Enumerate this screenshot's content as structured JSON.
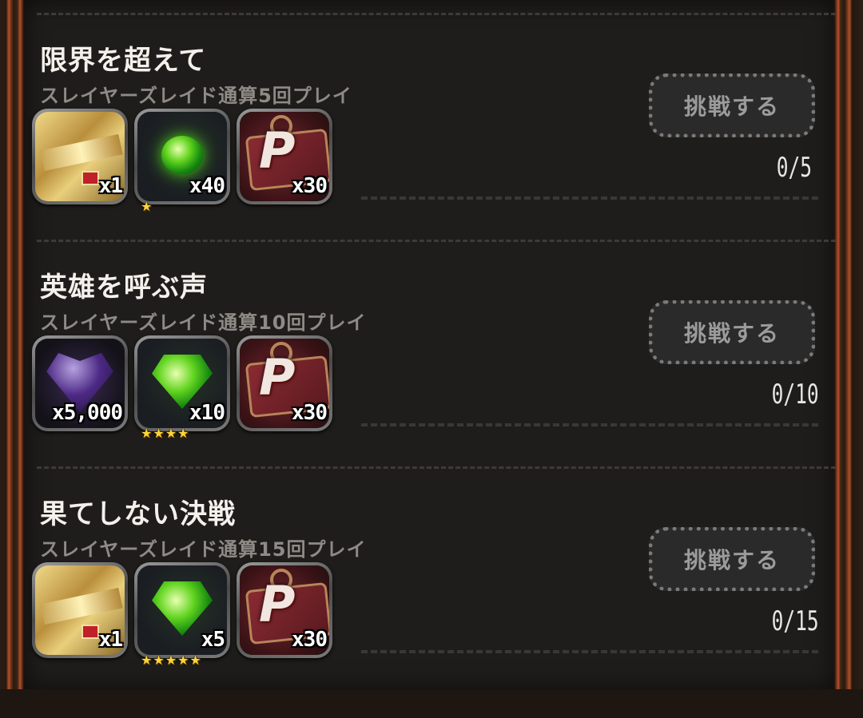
{
  "missions": [
    {
      "title": "限界を超えて",
      "description": "スレイヤーズレイド通算5回プレイ",
      "button_label": "挑戦する",
      "progress": "0/5",
      "rewards": [
        {
          "item": "gold-card",
          "count": "x1",
          "stars": ""
        },
        {
          "item": "green-orb",
          "count": "x40",
          "stars": "★"
        },
        {
          "item": "p-ticket",
          "count": "x30",
          "stars": ""
        }
      ]
    },
    {
      "title": "英雄を呼ぶ声",
      "description": "スレイヤーズレイド通算10回プレイ",
      "button_label": "挑戦する",
      "progress": "0/10",
      "rewards": [
        {
          "item": "purple-heart-gem",
          "count": "x5,000",
          "stars": ""
        },
        {
          "item": "green-gem",
          "count": "x10",
          "stars": "★★★★"
        },
        {
          "item": "p-ticket",
          "count": "x30",
          "stars": ""
        }
      ]
    },
    {
      "title": "果てしない決戦",
      "description": "スレイヤーズレイド通算15回プレイ",
      "button_label": "挑戦する",
      "progress": "0/15",
      "rewards": [
        {
          "item": "gold-card",
          "count": "x1",
          "stars": ""
        },
        {
          "item": "green-gem",
          "count": "x5",
          "stars": "★★★★★"
        },
        {
          "item": "p-ticket",
          "count": "x30",
          "stars": ""
        }
      ]
    }
  ],
  "icons": {
    "ticket_letter": "P"
  },
  "colors": {
    "title": "#f4f1ec",
    "description": "#8e8a86",
    "star": "#ffd43a",
    "button_text": "#9b9b9b",
    "frame": "#b5512a"
  }
}
